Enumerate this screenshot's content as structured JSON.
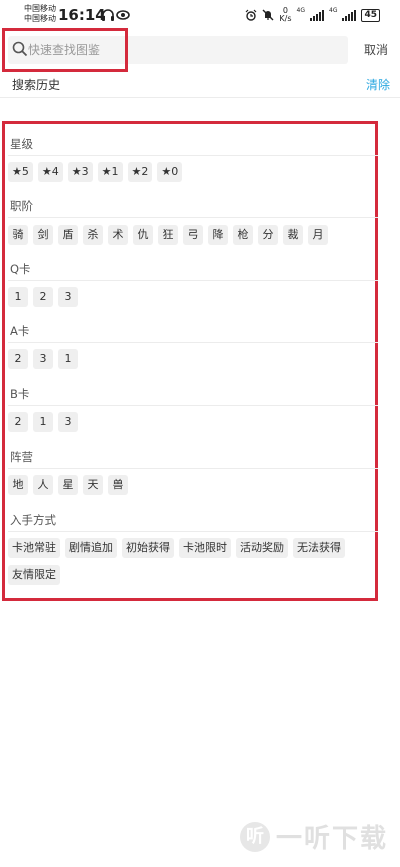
{
  "status": {
    "carrier1": "中国移动",
    "carrier2": "中国移动",
    "time": "16:14",
    "speed_value": "0",
    "speed_unit": "K/s",
    "net1": "4G",
    "net2": "4G",
    "battery": "45"
  },
  "search": {
    "placeholder": "快速查找图鉴",
    "cancel_label": "取消"
  },
  "history": {
    "title": "搜索历史",
    "clear_label": "清除"
  },
  "sections": [
    {
      "title": "星级",
      "chips": [
        "★5",
        "★4",
        "★3",
        "★1",
        "★2",
        "★0"
      ]
    },
    {
      "title": "职阶",
      "chips": [
        "骑",
        "剑",
        "盾",
        "杀",
        "术",
        "仇",
        "狂",
        "弓",
        "降",
        "枪",
        "分",
        "裁",
        "月"
      ]
    },
    {
      "title": "Q卡",
      "chips": [
        "1",
        "2",
        "3"
      ]
    },
    {
      "title": "A卡",
      "chips": [
        "2",
        "3",
        "1"
      ]
    },
    {
      "title": "B卡",
      "chips": [
        "2",
        "1",
        "3"
      ]
    },
    {
      "title": "阵营",
      "chips": [
        "地",
        "人",
        "星",
        "天",
        "兽"
      ]
    },
    {
      "title": "入手方式",
      "chips": [
        "卡池常驻",
        "剧情追加",
        "初始获得",
        "卡池限时",
        "活动奖励",
        "无法获得",
        "友情限定"
      ]
    }
  ],
  "watermark": {
    "logo_glyph": "听",
    "text": "一听下载"
  },
  "colors": {
    "highlight": "#d42a3c",
    "link": "#2aa7e0",
    "chip_bg": "#efefef"
  }
}
